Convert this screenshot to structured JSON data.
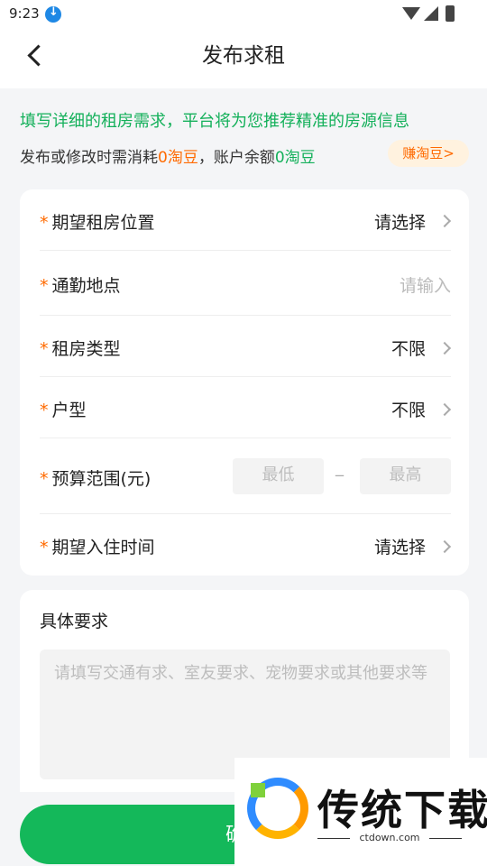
{
  "status_bar": {
    "time": "9:23"
  },
  "header": {
    "title": "发布求租"
  },
  "notice": {
    "headline": "填写详细的租房需求，平台将为您推荐精准的房源信息",
    "cost_prefix": "发布或修改时需消耗",
    "cost_amount": "0淘豆",
    "balance_prefix": "，账户余额",
    "balance_amount": "0淘豆",
    "earn_button": "赚淘豆>"
  },
  "form": {
    "rows": [
      {
        "label": "期望租房位置",
        "value": "请选择"
      },
      {
        "label": "通勤地点",
        "placeholder": "请输入"
      },
      {
        "label": "租房类型",
        "value": "不限"
      },
      {
        "label": "户型",
        "value": "不限"
      },
      {
        "label": "预算范围(元)",
        "min_placeholder": "最低",
        "separator": "_",
        "max_placeholder": "最高"
      },
      {
        "label": "期望入住时间",
        "value": "请选择"
      }
    ],
    "required_mark": "*"
  },
  "requirements": {
    "title": "具体要求",
    "placeholder": "请填写交通有求、室友要求、宠物要求或其他要求等"
  },
  "confirm_button": "确定",
  "watermark": {
    "text": "传统下载",
    "url": "ctdown.com"
  },
  "colors": {
    "brand_green": "#14b85a",
    "accent_orange": "#ff6a00"
  }
}
